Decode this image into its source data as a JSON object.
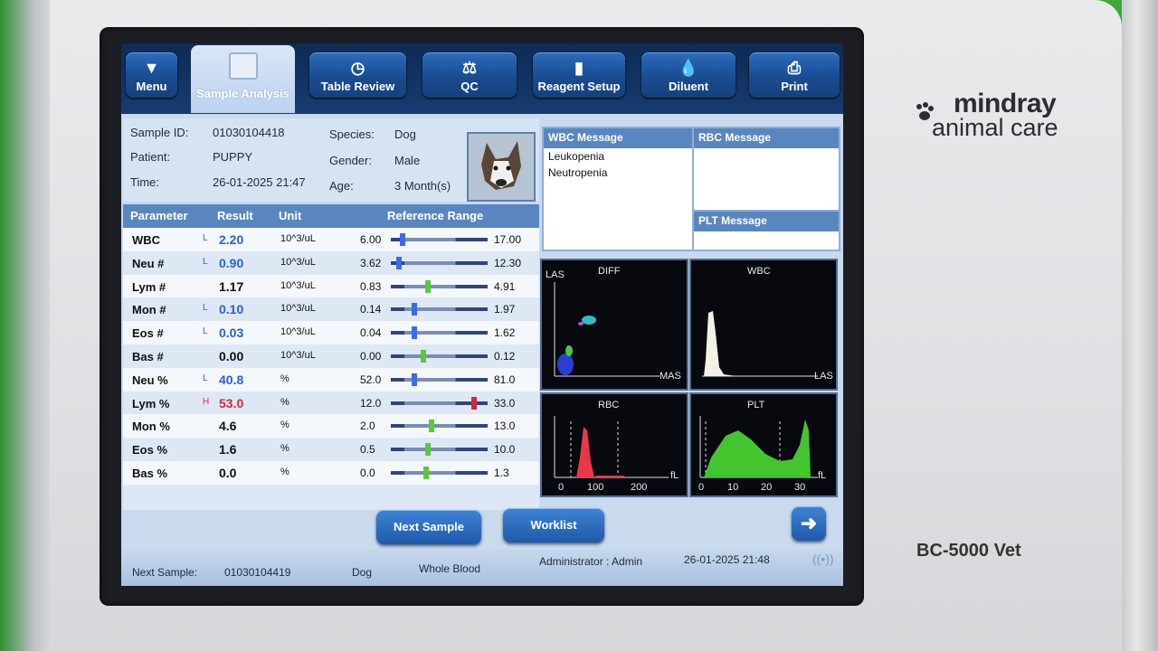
{
  "brand": {
    "line1": "mindray",
    "line2": "animal care",
    "model": "BC-5000 Vet"
  },
  "tabs": [
    {
      "label": "Menu",
      "icon": "triangle-down-icon"
    },
    {
      "label": "Sample Analysis",
      "icon": "chart-icon",
      "active": true
    },
    {
      "label": "Table Review",
      "icon": "clock-icon"
    },
    {
      "label": "QC",
      "icon": "scale-icon"
    },
    {
      "label": "Reagent Setup",
      "icon": "bottles-icon"
    },
    {
      "label": "Diluent",
      "icon": "drop-icon"
    },
    {
      "label": "Print",
      "icon": "printer-icon"
    }
  ],
  "sample": {
    "id_label": "Sample ID:",
    "id": "01030104418",
    "patient_label": "Patient:",
    "patient": "PUPPY",
    "time_label": "Time:",
    "time": "26-01-2025 21:47",
    "species_label": "Species:",
    "species": "Dog",
    "gender_label": "Gender:",
    "gender": "Male",
    "age_label": "Age:",
    "age": "3 Month(s)"
  },
  "table": {
    "headers": {
      "parameter": "Parameter",
      "result": "Result",
      "unit": "Unit",
      "range": "Reference Range"
    },
    "rows": [
      {
        "param": "WBC",
        "flag": "L",
        "result": "2.20",
        "unit": "10^3/uL",
        "low": "6.00",
        "high": "17.00",
        "marker": 0.12,
        "color": "#2b5fd9",
        "mcolor": "#3a6ce8"
      },
      {
        "param": "Neu #",
        "flag": "L",
        "result": "0.90",
        "unit": "10^3/uL",
        "low": "3.62",
        "high": "12.30",
        "marker": 0.08,
        "color": "#2b5fd9",
        "mcolor": "#3a6ce8"
      },
      {
        "param": "Lym #",
        "flag": "",
        "result": "1.17",
        "unit": "10^3/uL",
        "low": "0.83",
        "high": "4.91",
        "marker": 0.38,
        "color": "#111111",
        "mcolor": "#5cc83a"
      },
      {
        "param": "Mon #",
        "flag": "L",
        "result": "0.10",
        "unit": "10^3/uL",
        "low": "0.14",
        "high": "1.97",
        "marker": 0.24,
        "color": "#2b5fd9",
        "mcolor": "#3a6ce8"
      },
      {
        "param": "Eos #",
        "flag": "L",
        "result": "0.03",
        "unit": "10^3/uL",
        "low": "0.04",
        "high": "1.62",
        "marker": 0.24,
        "color": "#2b5fd9",
        "mcolor": "#3a6ce8"
      },
      {
        "param": "Bas #",
        "flag": "",
        "result": "0.00",
        "unit": "10^3/uL",
        "low": "0.00",
        "high": "0.12",
        "marker": 0.34,
        "color": "#111111",
        "mcolor": "#5cc83a"
      },
      {
        "param": "Neu %",
        "flag": "L",
        "result": "40.8",
        "unit": "%",
        "low": "52.0",
        "high": "81.0",
        "marker": 0.24,
        "color": "#2b5fd9",
        "mcolor": "#3a6ce8"
      },
      {
        "param": "Lym %",
        "flag": "H",
        "result": "53.0",
        "unit": "%",
        "low": "12.0",
        "high": "33.0",
        "marker": 0.86,
        "color": "#d7263d",
        "mcolor": "#d7263d"
      },
      {
        "param": "Mon %",
        "flag": "",
        "result": "4.6",
        "unit": "%",
        "low": "2.0",
        "high": "13.0",
        "marker": 0.42,
        "color": "#111111",
        "mcolor": "#5cc83a"
      },
      {
        "param": "Eos %",
        "flag": "",
        "result": "1.6",
        "unit": "%",
        "low": "0.5",
        "high": "10.0",
        "marker": 0.38,
        "color": "#111111",
        "mcolor": "#5cc83a"
      },
      {
        "param": "Bas %",
        "flag": "",
        "result": "0.0",
        "unit": "%",
        "low": "0.0",
        "high": "1.3",
        "marker": 0.36,
        "color": "#111111",
        "mcolor": "#5cc83a"
      }
    ]
  },
  "messages": {
    "wbc_title": "WBC Message",
    "wbc_lines": [
      "Leukopenia",
      "Neutropenia"
    ],
    "rbc_title": "RBC Message",
    "plt_title": "PLT Message"
  },
  "graphs": {
    "diff": {
      "title": "DIFF",
      "y": "LAS",
      "x": "MAS"
    },
    "wbc": {
      "title": "WBC",
      "x": "LAS"
    },
    "rbc": {
      "title": "RBC",
      "ticks": [
        "0",
        "100",
        "200"
      ],
      "unit": "fL"
    },
    "plt": {
      "title": "PLT",
      "ticks": [
        "0",
        "10",
        "20",
        "30"
      ],
      "unit": "fL"
    }
  },
  "buttons": {
    "next_sample": "Next Sample",
    "worklist": "Worklist",
    "arrow": "right-arrow-icon"
  },
  "status": {
    "next_label": "Next Sample:",
    "next_id": "01030104419",
    "species": "Dog",
    "sample_type": "Whole Blood",
    "user": "Administrator : Admin",
    "datetime": "26-01-2025 21:48"
  }
}
